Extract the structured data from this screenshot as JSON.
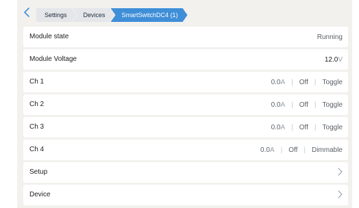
{
  "breadcrumb": [
    "Settings",
    "Devices",
    "SmartSwitchDC4 (1)"
  ],
  "module_state": {
    "label": "Module state",
    "value": "Running"
  },
  "module_voltage": {
    "label": "Module Voltage",
    "value": "12.0",
    "unit": "V"
  },
  "channels": [
    {
      "label": "Ch 1",
      "current": "0.0",
      "unit": "A",
      "state": "Off",
      "mode": "Toggle"
    },
    {
      "label": "Ch 2",
      "current": "0.0",
      "unit": "A",
      "state": "Off",
      "mode": "Toggle"
    },
    {
      "label": "Ch 3",
      "current": "0.0",
      "unit": "A",
      "state": "Off",
      "mode": "Toggle"
    },
    {
      "label": "Ch 4",
      "current": "0.0",
      "unit": "A",
      "state": "Off",
      "mode": "Dimmable"
    }
  ],
  "separator": "|",
  "menu": {
    "setup": "Setup",
    "device": "Device"
  },
  "colors": {
    "accent": "#3f8ed8",
    "background": "#f2f1ee",
    "row": "#ffffff"
  },
  "icons": {
    "back": "chevron-left-icon",
    "navigate": "chevron-right-icon"
  }
}
